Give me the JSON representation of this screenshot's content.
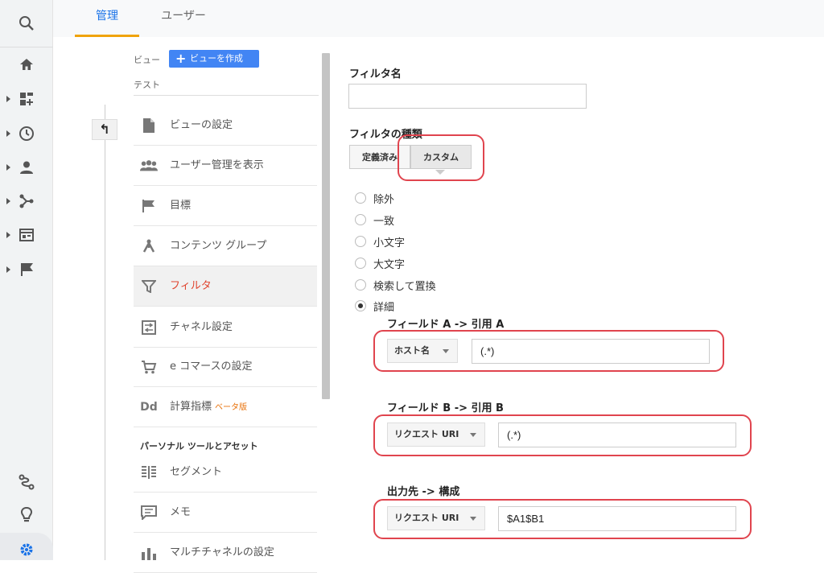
{
  "tabs": {
    "admin": "管理",
    "user": "ユーザー"
  },
  "nav": {
    "view_label": "ビュー",
    "create_view": "ビューを作成",
    "view_name": "テスト",
    "back": "↰",
    "items": [
      {
        "label": "ビューの設定",
        "icon": "document-icon"
      },
      {
        "label": "ユーザー管理を表示",
        "icon": "users-icon"
      },
      {
        "label": "目標",
        "icon": "flag-icon"
      },
      {
        "label": "コンテンツ グループ",
        "icon": "content-group-icon"
      },
      {
        "label": "フィルタ",
        "icon": "filter-icon"
      },
      {
        "label": "チャネル設定",
        "icon": "channel-icon"
      },
      {
        "label": "e コマースの設定",
        "icon": "cart-icon"
      },
      {
        "label": "計算指標",
        "badge": "ベータ版",
        "icon": "dd-icon"
      }
    ],
    "section_header": "パーソナル ツールとアセット",
    "section_items": [
      {
        "label": "セグメント",
        "icon": "segment-icon"
      },
      {
        "label": "メモ",
        "icon": "memo-icon"
      },
      {
        "label": "マルチチャネルの設定",
        "icon": "multichannel-icon"
      }
    ]
  },
  "form": {
    "filter_name_label": "フィルタ名",
    "filter_name_value": "",
    "filter_type_label": "フィルタの種類",
    "type_predefined": "定義済み",
    "type_custom": "カスタム",
    "options": [
      "除外",
      "一致",
      "小文字",
      "大文字",
      "検索して置換",
      "詳細"
    ],
    "selected_option": "詳細",
    "field_a_label": "フィールド A -> 引用 A",
    "field_a_select": "ホスト名",
    "field_a_value": "(.*)",
    "field_b_label": "フィールド B -> 引用 B",
    "field_b_select": "リクエスト URI",
    "field_b_value": "(.*)",
    "output_label": "出力先 -> 構成",
    "output_select": "リクエスト URI",
    "output_value": "$A1$B1"
  },
  "colors": {
    "accent": "#1a73e8",
    "tab_underline": "#f0a30a",
    "active_nav": "#e0442e",
    "highlight": "#e0444e",
    "create_button": "#4285f4"
  }
}
